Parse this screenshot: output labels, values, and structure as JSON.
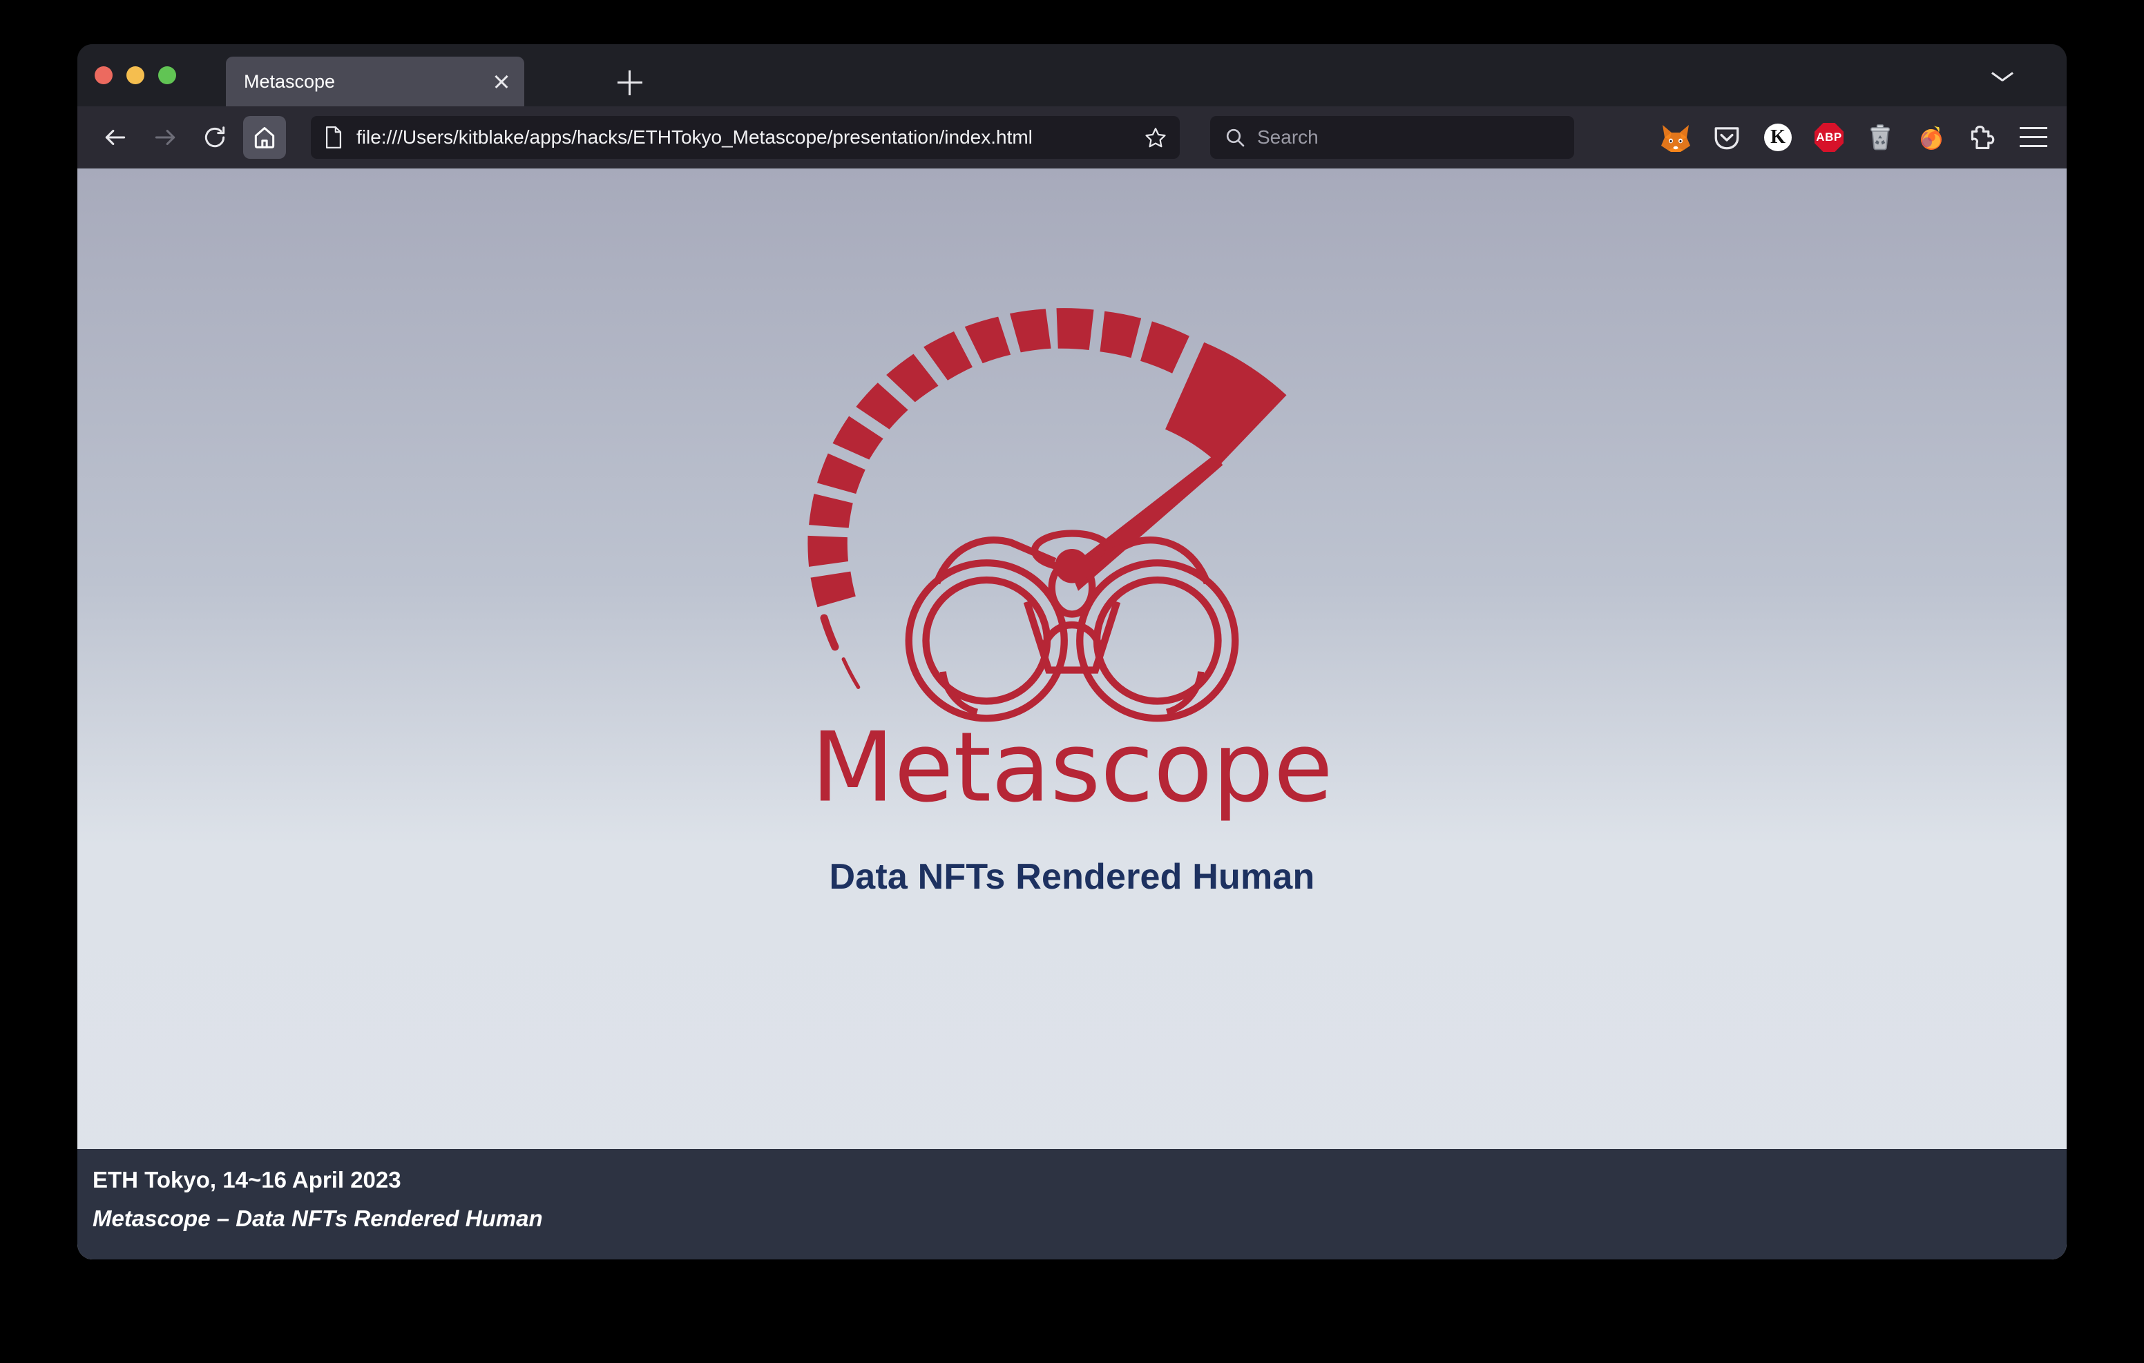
{
  "browser": {
    "window_controls": {
      "close_label": "close",
      "minimize_label": "minimize",
      "maximize_label": "maximize"
    },
    "tab": {
      "title": "Metascope",
      "close_label": "×"
    },
    "new_tab_label": "+",
    "nav": {
      "back_label": "Back",
      "forward_label": "Forward",
      "reload_label": "Reload",
      "home_label": "Home"
    },
    "address": {
      "url": "file:///Users/kitblake/apps/hacks/ETHTokyo_Metascope/presentation/index.html",
      "bookmark_label": "Bookmark this page"
    },
    "search": {
      "placeholder": "Search"
    },
    "extensions": [
      {
        "name": "metamask-icon",
        "label": "MetaMask"
      },
      {
        "name": "pocket-icon",
        "label": "Pocket"
      },
      {
        "name": "keplr-icon",
        "label": "K"
      },
      {
        "name": "adblock-plus-icon",
        "label": "ABP"
      },
      {
        "name": "trash-icon",
        "label": "Empty Cache"
      },
      {
        "name": "firefox-icon",
        "label": "Firefox"
      },
      {
        "name": "puzzle-extensions-icon",
        "label": "Extensions"
      },
      {
        "name": "hamburger-menu-icon",
        "label": "Open application menu"
      }
    ]
  },
  "slide": {
    "logo": {
      "wordmark": "Metascope",
      "alt": "Metascope gauge and binoculars logo",
      "color": "#b62636"
    },
    "title": "Data NFTs Rendered Human",
    "title_color": "#1d3160",
    "footer": {
      "event": "ETH Tokyo, 14~16 April 2023",
      "subtitle": "Metascope – Data NFTs Rendered Human",
      "background": "#2d3342"
    },
    "background_top": "#a7aabb",
    "background_bottom": "#dee3ea"
  }
}
